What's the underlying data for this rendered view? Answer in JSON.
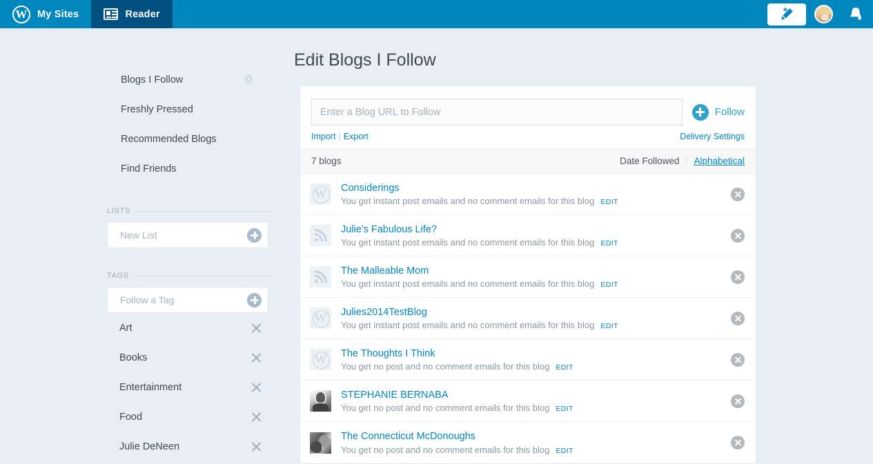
{
  "masterbar": {
    "logo_icon": "wordpress-logo-icon",
    "items": [
      {
        "label": "My Sites",
        "icon": "wordpress-logo-icon",
        "active": false
      },
      {
        "label": "Reader",
        "icon": "reader-newspaper-icon",
        "active": true
      }
    ],
    "new_post_icon": "pencil-plus-icon",
    "avatar_icon": "user-avatar",
    "notifications_icon": "bell-icon"
  },
  "sidebar": {
    "nav": [
      {
        "label": "Blogs I Follow",
        "icon": "gear-icon",
        "has_gear": true
      },
      {
        "label": "Freshly Pressed",
        "has_gear": false
      },
      {
        "label": "Recommended Blogs",
        "has_gear": false
      },
      {
        "label": "Find Friends",
        "has_gear": false
      }
    ],
    "lists": {
      "title": "LISTS",
      "new_list_placeholder": "New List",
      "add_icon": "plus-circle-icon"
    },
    "tags": {
      "title": "TAGS",
      "follow_tag_placeholder": "Follow a Tag",
      "add_icon": "plus-circle-icon",
      "items": [
        {
          "label": "Art",
          "remove_icon": "close-x-icon"
        },
        {
          "label": "Books",
          "remove_icon": "close-x-icon"
        },
        {
          "label": "Entertainment",
          "remove_icon": "close-x-icon"
        },
        {
          "label": "Food",
          "remove_icon": "close-x-icon"
        },
        {
          "label": "Julie DeNeen",
          "remove_icon": "close-x-icon"
        }
      ]
    }
  },
  "main": {
    "title": "Edit Blogs I Follow",
    "follow_form": {
      "url_placeholder": "Enter a Blog URL to Follow",
      "url_value": "",
      "follow_label": "Follow",
      "follow_icon": "plus-circle-icon",
      "import_label": "Import",
      "separator": "|",
      "export_label": "Export",
      "delivery_settings_label": "Delivery Settings"
    },
    "sortbar": {
      "count_label": "7 blogs",
      "sort_date_label": "Date Followed",
      "sort_alpha_label": "Alphabetical",
      "active_sort": "Alphabetical"
    },
    "blogs": [
      {
        "name": "Considerings",
        "description": "You get instant post emails and no comment emails for this blog",
        "edit_label": "EDIT",
        "avatar_type": "wp",
        "avatar_icon": "wordpress-logo-icon",
        "remove_icon": "close-circle-icon"
      },
      {
        "name": "Julie's Fabulous Life?",
        "description": "You get instant post emails and no comment emails for this blog",
        "edit_label": "EDIT",
        "avatar_type": "rss",
        "avatar_icon": "rss-feed-icon",
        "remove_icon": "close-circle-icon"
      },
      {
        "name": "The Malleable Mom",
        "description": "You get instant post emails and no comment emails for this blog",
        "edit_label": "EDIT",
        "avatar_type": "rss",
        "avatar_icon": "rss-feed-icon",
        "remove_icon": "close-circle-icon"
      },
      {
        "name": "Julies2014TestBlog",
        "description": "You get instant post emails and no comment emails for this blog",
        "edit_label": "EDIT",
        "avatar_type": "wp",
        "avatar_icon": "wordpress-logo-icon",
        "remove_icon": "close-circle-icon"
      },
      {
        "name": "The Thoughts I Think",
        "description": "You get no post and no comment emails for this blog",
        "edit_label": "EDIT",
        "avatar_type": "wp",
        "avatar_icon": "wordpress-logo-icon",
        "remove_icon": "close-circle-icon"
      },
      {
        "name": "STEPHANIE BERNABA",
        "description": "You get no post and no comment emails for this blog",
        "edit_label": "EDIT",
        "avatar_type": "photo-1",
        "avatar_icon": "blog-avatar",
        "remove_icon": "close-circle-icon"
      },
      {
        "name": "The Connecticut McDonoughs",
        "description": "You get no post and no comment emails for this blog",
        "edit_label": "EDIT",
        "avatar_type": "photo-2",
        "avatar_icon": "blog-avatar",
        "remove_icon": "close-circle-icon"
      }
    ]
  },
  "colors": {
    "masterbar": "#0087be",
    "masterbar_active": "#005082",
    "page_background": "#e8eef4",
    "link": "#0087be",
    "accent": "#2ea2cc",
    "text": "#3d4a52",
    "muted_text": "#8a979f"
  }
}
